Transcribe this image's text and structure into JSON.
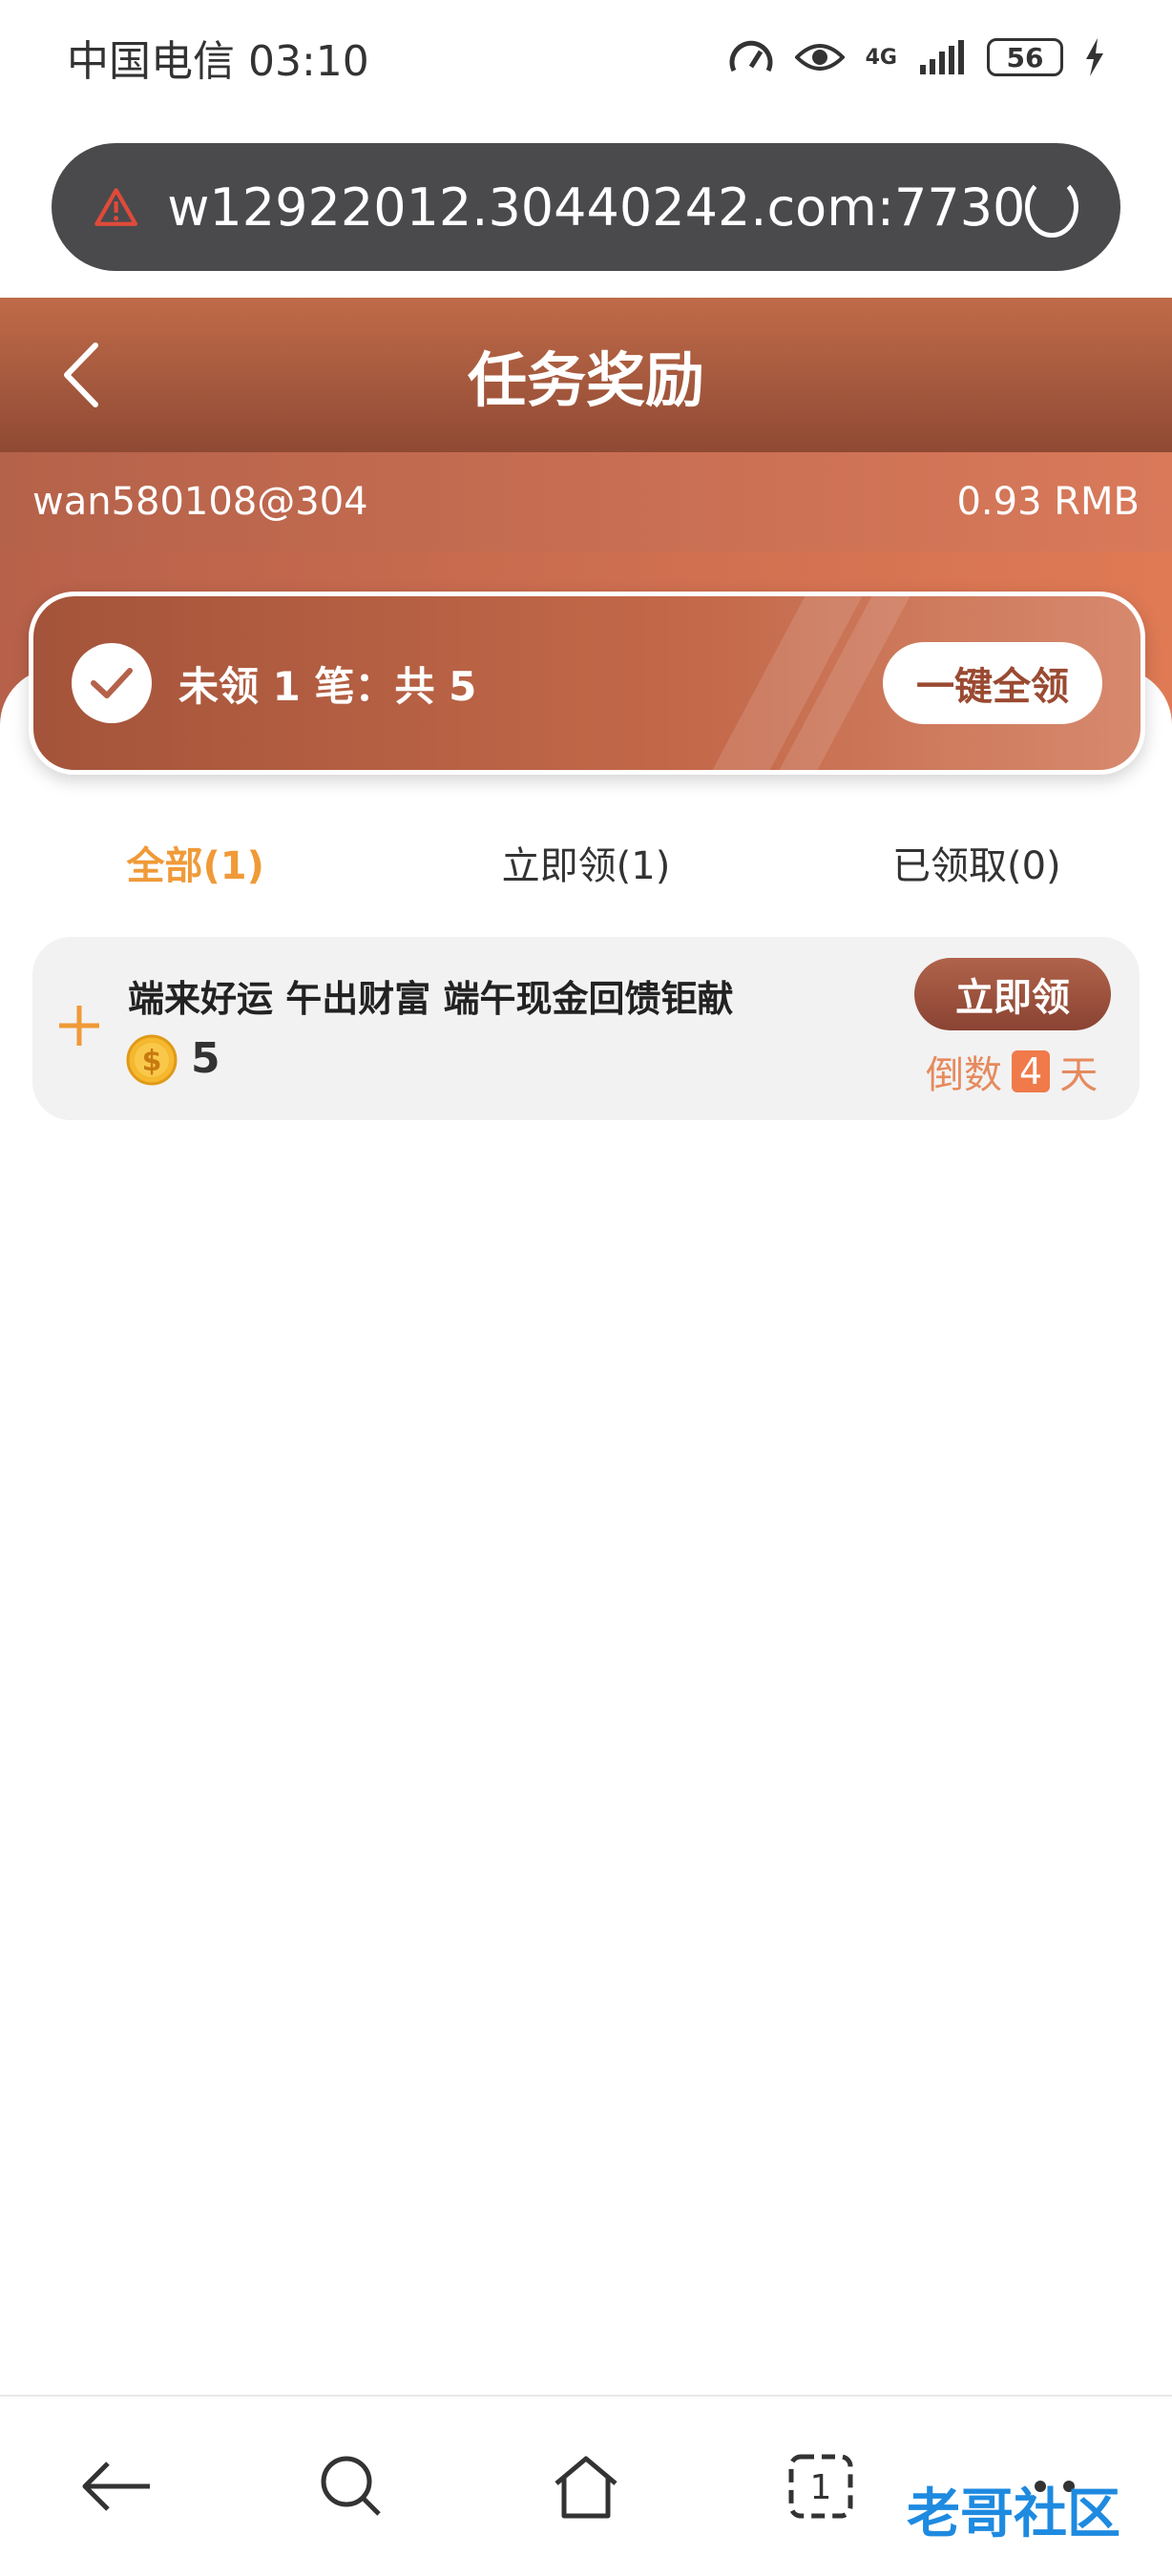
{
  "status_bar": {
    "carrier_time": "中国电信 03:10",
    "network": "4G",
    "battery": "56"
  },
  "address_bar": {
    "url": "w12922012.30440242.com:7730"
  },
  "header": {
    "title": "任务奖励"
  },
  "account": {
    "username": "wan580108@304",
    "balance": "0.93 RMB"
  },
  "summary": {
    "text": "未领 1 笔：共 5",
    "claim_all_label": "一键全领"
  },
  "tabs": [
    {
      "label": "全部(1)",
      "active": true
    },
    {
      "label": "立即领(1)",
      "active": false
    },
    {
      "label": "已领取(0)",
      "active": false
    }
  ],
  "tasks": [
    {
      "title": "端来好运 午出财富 端午现金回馈钜献",
      "reward": "5",
      "claim_label": "立即领",
      "countdown_prefix": "倒数",
      "countdown_days": "4",
      "countdown_suffix": "天"
    }
  ],
  "watermark": "老哥社区",
  "colors": {
    "accent": "#c06b49",
    "tab_active": "#f09a38",
    "countdown": "#e68a5e"
  }
}
